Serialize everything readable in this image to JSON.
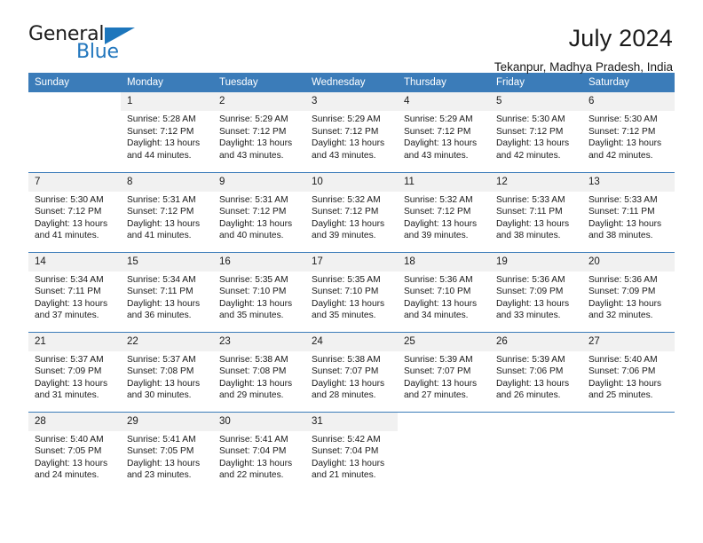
{
  "logo": {
    "word_top": "General",
    "word_bottom": "Blue",
    "triangle_color": "#1d76bc",
    "blue": "#2176bd"
  },
  "header": {
    "title": "July 2024",
    "subtitle": "Tekanpur, Madhya Pradesh, India"
  },
  "calendar": {
    "accent_color": "#3b7cb9",
    "daynum_bg": "#f1f1f1",
    "weekday_headers": [
      "Sunday",
      "Monday",
      "Tuesday",
      "Wednesday",
      "Thursday",
      "Friday",
      "Saturday"
    ],
    "labels": {
      "sunrise": "Sunrise:",
      "sunset": "Sunset:",
      "daylight": "Daylight:"
    },
    "weeks": [
      [
        {
          "day": "",
          "blank": true
        },
        {
          "day": "1",
          "sunrise": "Sunrise: 5:28 AM",
          "sunset": "Sunset: 7:12 PM",
          "daylight_line1": "Daylight: 13 hours",
          "daylight_line2": "and 44 minutes."
        },
        {
          "day": "2",
          "sunrise": "Sunrise: 5:29 AM",
          "sunset": "Sunset: 7:12 PM",
          "daylight_line1": "Daylight: 13 hours",
          "daylight_line2": "and 43 minutes."
        },
        {
          "day": "3",
          "sunrise": "Sunrise: 5:29 AM",
          "sunset": "Sunset: 7:12 PM",
          "daylight_line1": "Daylight: 13 hours",
          "daylight_line2": "and 43 minutes."
        },
        {
          "day": "4",
          "sunrise": "Sunrise: 5:29 AM",
          "sunset": "Sunset: 7:12 PM",
          "daylight_line1": "Daylight: 13 hours",
          "daylight_line2": "and 43 minutes."
        },
        {
          "day": "5",
          "sunrise": "Sunrise: 5:30 AM",
          "sunset": "Sunset: 7:12 PM",
          "daylight_line1": "Daylight: 13 hours",
          "daylight_line2": "and 42 minutes."
        },
        {
          "day": "6",
          "sunrise": "Sunrise: 5:30 AM",
          "sunset": "Sunset: 7:12 PM",
          "daylight_line1": "Daylight: 13 hours",
          "daylight_line2": "and 42 minutes."
        }
      ],
      [
        {
          "day": "7",
          "sunrise": "Sunrise: 5:30 AM",
          "sunset": "Sunset: 7:12 PM",
          "daylight_line1": "Daylight: 13 hours",
          "daylight_line2": "and 41 minutes."
        },
        {
          "day": "8",
          "sunrise": "Sunrise: 5:31 AM",
          "sunset": "Sunset: 7:12 PM",
          "daylight_line1": "Daylight: 13 hours",
          "daylight_line2": "and 41 minutes."
        },
        {
          "day": "9",
          "sunrise": "Sunrise: 5:31 AM",
          "sunset": "Sunset: 7:12 PM",
          "daylight_line1": "Daylight: 13 hours",
          "daylight_line2": "and 40 minutes."
        },
        {
          "day": "10",
          "sunrise": "Sunrise: 5:32 AM",
          "sunset": "Sunset: 7:12 PM",
          "daylight_line1": "Daylight: 13 hours",
          "daylight_line2": "and 39 minutes."
        },
        {
          "day": "11",
          "sunrise": "Sunrise: 5:32 AM",
          "sunset": "Sunset: 7:12 PM",
          "daylight_line1": "Daylight: 13 hours",
          "daylight_line2": "and 39 minutes."
        },
        {
          "day": "12",
          "sunrise": "Sunrise: 5:33 AM",
          "sunset": "Sunset: 7:11 PM",
          "daylight_line1": "Daylight: 13 hours",
          "daylight_line2": "and 38 minutes."
        },
        {
          "day": "13",
          "sunrise": "Sunrise: 5:33 AM",
          "sunset": "Sunset: 7:11 PM",
          "daylight_line1": "Daylight: 13 hours",
          "daylight_line2": "and 38 minutes."
        }
      ],
      [
        {
          "day": "14",
          "sunrise": "Sunrise: 5:34 AM",
          "sunset": "Sunset: 7:11 PM",
          "daylight_line1": "Daylight: 13 hours",
          "daylight_line2": "and 37 minutes."
        },
        {
          "day": "15",
          "sunrise": "Sunrise: 5:34 AM",
          "sunset": "Sunset: 7:11 PM",
          "daylight_line1": "Daylight: 13 hours",
          "daylight_line2": "and 36 minutes."
        },
        {
          "day": "16",
          "sunrise": "Sunrise: 5:35 AM",
          "sunset": "Sunset: 7:10 PM",
          "daylight_line1": "Daylight: 13 hours",
          "daylight_line2": "and 35 minutes."
        },
        {
          "day": "17",
          "sunrise": "Sunrise: 5:35 AM",
          "sunset": "Sunset: 7:10 PM",
          "daylight_line1": "Daylight: 13 hours",
          "daylight_line2": "and 35 minutes."
        },
        {
          "day": "18",
          "sunrise": "Sunrise: 5:36 AM",
          "sunset": "Sunset: 7:10 PM",
          "daylight_line1": "Daylight: 13 hours",
          "daylight_line2": "and 34 minutes."
        },
        {
          "day": "19",
          "sunrise": "Sunrise: 5:36 AM",
          "sunset": "Sunset: 7:09 PM",
          "daylight_line1": "Daylight: 13 hours",
          "daylight_line2": "and 33 minutes."
        },
        {
          "day": "20",
          "sunrise": "Sunrise: 5:36 AM",
          "sunset": "Sunset: 7:09 PM",
          "daylight_line1": "Daylight: 13 hours",
          "daylight_line2": "and 32 minutes."
        }
      ],
      [
        {
          "day": "21",
          "sunrise": "Sunrise: 5:37 AM",
          "sunset": "Sunset: 7:09 PM",
          "daylight_line1": "Daylight: 13 hours",
          "daylight_line2": "and 31 minutes."
        },
        {
          "day": "22",
          "sunrise": "Sunrise: 5:37 AM",
          "sunset": "Sunset: 7:08 PM",
          "daylight_line1": "Daylight: 13 hours",
          "daylight_line2": "and 30 minutes."
        },
        {
          "day": "23",
          "sunrise": "Sunrise: 5:38 AM",
          "sunset": "Sunset: 7:08 PM",
          "daylight_line1": "Daylight: 13 hours",
          "daylight_line2": "and 29 minutes."
        },
        {
          "day": "24",
          "sunrise": "Sunrise: 5:38 AM",
          "sunset": "Sunset: 7:07 PM",
          "daylight_line1": "Daylight: 13 hours",
          "daylight_line2": "and 28 minutes."
        },
        {
          "day": "25",
          "sunrise": "Sunrise: 5:39 AM",
          "sunset": "Sunset: 7:07 PM",
          "daylight_line1": "Daylight: 13 hours",
          "daylight_line2": "and 27 minutes."
        },
        {
          "day": "26",
          "sunrise": "Sunrise: 5:39 AM",
          "sunset": "Sunset: 7:06 PM",
          "daylight_line1": "Daylight: 13 hours",
          "daylight_line2": "and 26 minutes."
        },
        {
          "day": "27",
          "sunrise": "Sunrise: 5:40 AM",
          "sunset": "Sunset: 7:06 PM",
          "daylight_line1": "Daylight: 13 hours",
          "daylight_line2": "and 25 minutes."
        }
      ],
      [
        {
          "day": "28",
          "sunrise": "Sunrise: 5:40 AM",
          "sunset": "Sunset: 7:05 PM",
          "daylight_line1": "Daylight: 13 hours",
          "daylight_line2": "and 24 minutes."
        },
        {
          "day": "29",
          "sunrise": "Sunrise: 5:41 AM",
          "sunset": "Sunset: 7:05 PM",
          "daylight_line1": "Daylight: 13 hours",
          "daylight_line2": "and 23 minutes."
        },
        {
          "day": "30",
          "sunrise": "Sunrise: 5:41 AM",
          "sunset": "Sunset: 7:04 PM",
          "daylight_line1": "Daylight: 13 hours",
          "daylight_line2": "and 22 minutes."
        },
        {
          "day": "31",
          "sunrise": "Sunrise: 5:42 AM",
          "sunset": "Sunset: 7:04 PM",
          "daylight_line1": "Daylight: 13 hours",
          "daylight_line2": "and 21 minutes."
        },
        {
          "day": "",
          "blank": true
        },
        {
          "day": "",
          "blank": true
        },
        {
          "day": "",
          "blank": true
        }
      ]
    ]
  }
}
